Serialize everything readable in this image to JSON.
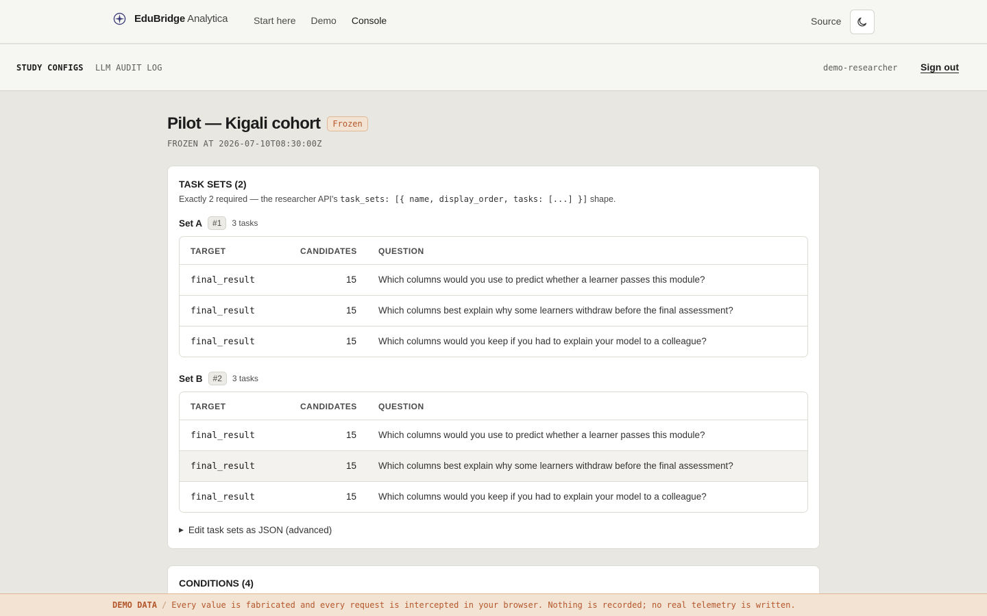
{
  "brand": {
    "name_bold": "EduBridge",
    "name_rest": " Analytica"
  },
  "topnav": {
    "links": [
      {
        "label": "Start here"
      },
      {
        "label": "Demo"
      },
      {
        "label": "Console"
      }
    ],
    "source_label": "Source",
    "theme_icon": "moon-icon"
  },
  "subnav": {
    "tab_active": "STUDY CONFIGS",
    "tab_inactive": "LLM AUDIT LOG",
    "user": "demo-researcher",
    "signout": "Sign out"
  },
  "page": {
    "title": "Pilot — Kigali cohort",
    "status_badge": "Frozen",
    "frozen_at": "FROZEN AT 2026-07-10T08:30:00Z"
  },
  "tasksets": {
    "heading": "TASK SETS (2)",
    "desc_pre": "Exactly 2 required — the researcher API's ",
    "desc_code": "task_sets: [{ name, display_order, tasks: [...] }]",
    "desc_post": " shape.",
    "columns": {
      "target": "TARGET",
      "candidates": "CANDIDATES",
      "question": "QUESTION"
    },
    "sets": [
      {
        "name": "Set A",
        "order": "#1",
        "count": "3 tasks",
        "rows": [
          {
            "target": "final_result",
            "candidates": "15",
            "question": "Which columns would you use to predict whether a learner passes this module?"
          },
          {
            "target": "final_result",
            "candidates": "15",
            "question": "Which columns best explain why some learners withdraw before the final assessment?"
          },
          {
            "target": "final_result",
            "candidates": "15",
            "question": "Which columns would you keep if you had to explain your model to a colleague?"
          }
        ]
      },
      {
        "name": "Set B",
        "order": "#2",
        "count": "3 tasks",
        "rows": [
          {
            "target": "final_result",
            "candidates": "15",
            "question": "Which columns would you use to predict whether a learner passes this module?"
          },
          {
            "target": "final_result",
            "candidates": "15",
            "question": "Which columns best explain why some learners withdraw before the final assessment?"
          },
          {
            "target": "final_result",
            "candidates": "15",
            "question": "Which columns would you keep if you had to explain your model to a colleague?"
          }
        ]
      }
    ],
    "json_toggle": "Edit task sets as JSON (advanced)"
  },
  "conditions": {
    "heading": "CONDITIONS (4)"
  },
  "demo_banner": {
    "label": "DEMO DATA",
    "separator": "/",
    "message": "Every value is fabricated and every request is intercepted in your browser. Nothing is recorded; no real telemetry is written."
  }
}
